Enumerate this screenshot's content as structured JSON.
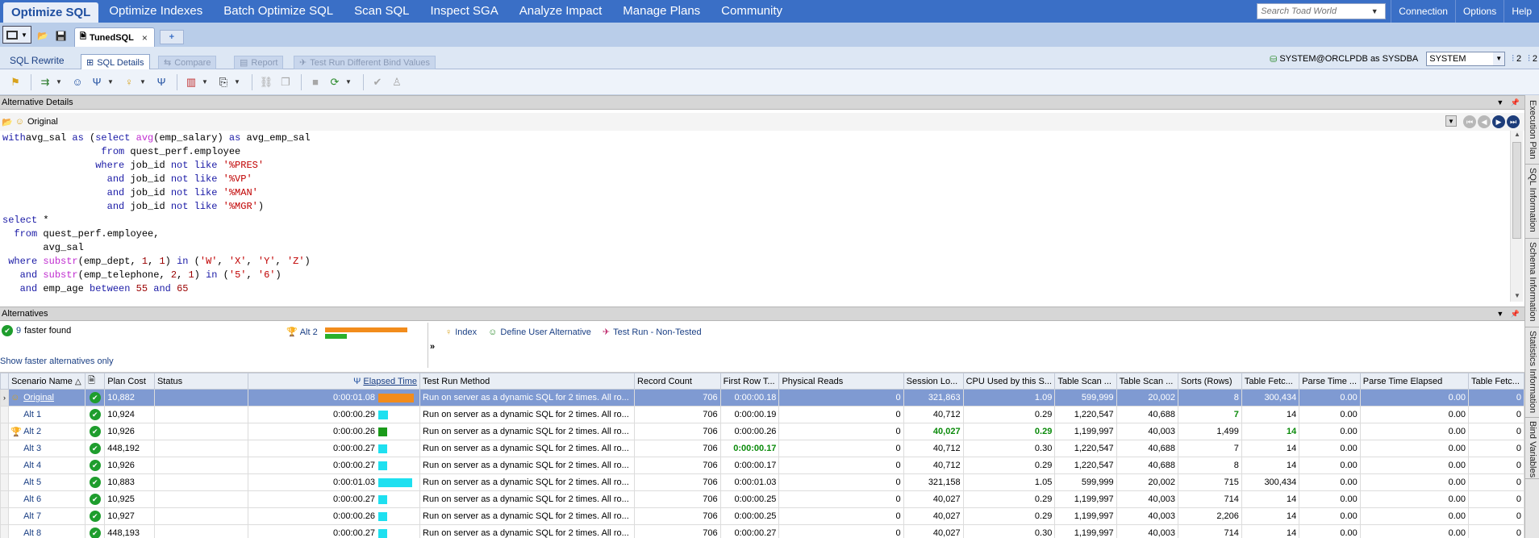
{
  "topnav": {
    "menu": [
      "Optimize SQL",
      "Optimize Indexes",
      "Batch Optimize SQL",
      "Scan SQL",
      "Inspect SGA",
      "Analyze Impact",
      "Manage Plans",
      "Community"
    ],
    "search_placeholder": "Search Toad World",
    "right_links": [
      "Connection",
      "Options",
      "Help"
    ]
  },
  "doc_tab": {
    "label": "TunedSQL",
    "close": "×",
    "add": "+"
  },
  "subtabs": {
    "sql_rewrite": "SQL Rewrite",
    "sql_details": "SQL Details",
    "compare": "Compare",
    "report": "Report",
    "test_run": "Test Run Different Bind Values"
  },
  "connection": {
    "label": "SYSTEM@ORCLPDB as SYSDBA",
    "schema": "SYSTEM",
    "count1": "2",
    "count2": "2"
  },
  "alt_details": {
    "title": "Alternative Details",
    "selected": "Original"
  },
  "sql_lines": [
    [
      [
        "kw",
        "with"
      ],
      [
        "",
        "avg_sal "
      ],
      [
        "kw",
        "as"
      ],
      [
        "",
        " ("
      ],
      [
        "kw",
        "select"
      ],
      [
        "",
        " "
      ],
      [
        "fn",
        "avg"
      ],
      [
        "",
        "(emp_salary) "
      ],
      [
        "kw",
        "as"
      ],
      [
        "",
        " avg_emp_sal"
      ]
    ],
    [
      [
        "",
        "                 "
      ],
      [
        "kw",
        "from"
      ],
      [
        "",
        " quest_perf.employee"
      ]
    ],
    [
      [
        "",
        "                "
      ],
      [
        "kw",
        "where"
      ],
      [
        "",
        " job_id "
      ],
      [
        "kw",
        "not like"
      ],
      [
        "",
        " "
      ],
      [
        "st",
        "'%PRES'"
      ]
    ],
    [
      [
        "",
        "                  "
      ],
      [
        "kw",
        "and"
      ],
      [
        "",
        " job_id "
      ],
      [
        "kw",
        "not like"
      ],
      [
        "",
        " "
      ],
      [
        "st",
        "'%VP'"
      ]
    ],
    [
      [
        "",
        "                  "
      ],
      [
        "kw",
        "and"
      ],
      [
        "",
        " job_id "
      ],
      [
        "kw",
        "not like"
      ],
      [
        "",
        " "
      ],
      [
        "st",
        "'%MAN'"
      ]
    ],
    [
      [
        "",
        "                  "
      ],
      [
        "kw",
        "and"
      ],
      [
        "",
        " job_id "
      ],
      [
        "kw",
        "not like"
      ],
      [
        "",
        " "
      ],
      [
        "st",
        "'%MGR'"
      ],
      [
        "",
        ")"
      ]
    ],
    [
      [
        "kw",
        "select"
      ],
      [
        "",
        " *"
      ]
    ],
    [
      [
        "",
        "  "
      ],
      [
        "kw",
        "from"
      ],
      [
        "",
        " quest_perf.employee,"
      ]
    ],
    [
      [
        "",
        "       avg_sal"
      ]
    ],
    [
      [
        "",
        ""
      ],
      [
        "kw",
        " where"
      ],
      [
        "",
        " "
      ],
      [
        "fn",
        "substr"
      ],
      [
        "",
        "(emp_dept, "
      ],
      [
        "nm",
        "1"
      ],
      [
        "",
        ", "
      ],
      [
        "nm",
        "1"
      ],
      [
        "",
        ") "
      ],
      [
        "kw",
        "in"
      ],
      [
        "",
        " ("
      ],
      [
        "st",
        "'W'"
      ],
      [
        "",
        ", "
      ],
      [
        "st",
        "'X'"
      ],
      [
        "",
        ", "
      ],
      [
        "st",
        "'Y'"
      ],
      [
        "",
        ", "
      ],
      [
        "st",
        "'Z'"
      ],
      [
        "",
        ")"
      ]
    ],
    [
      [
        "",
        "   "
      ],
      [
        "kw",
        "and"
      ],
      [
        "",
        " "
      ],
      [
        "fn",
        "substr"
      ],
      [
        "",
        "(emp_telephone, "
      ],
      [
        "nm",
        "2"
      ],
      [
        "",
        ", "
      ],
      [
        "nm",
        "1"
      ],
      [
        "",
        ") "
      ],
      [
        "kw",
        "in"
      ],
      [
        "",
        " ("
      ],
      [
        "st",
        "'5'"
      ],
      [
        "",
        ", "
      ],
      [
        "st",
        "'6'"
      ],
      [
        "",
        ")"
      ]
    ],
    [
      [
        "",
        "   "
      ],
      [
        "kw",
        "and"
      ],
      [
        "",
        " emp_age "
      ],
      [
        "kw",
        "between"
      ],
      [
        "",
        " "
      ],
      [
        "nm",
        "55"
      ],
      [
        "",
        " "
      ],
      [
        "kw",
        "and"
      ],
      [
        "",
        " "
      ],
      [
        "nm",
        "65"
      ]
    ]
  ],
  "side_tabs": [
    "Execution Plan",
    "SQL Information",
    "Schema Information",
    "Statistics Information",
    "Bind Variables"
  ],
  "alternatives": {
    "title": "Alternatives",
    "faster_count": "9",
    "faster_text": "faster found",
    "best_label": "Alt 2",
    "best_bar_fraction": 0.26,
    "actions": [
      "Index",
      "Define User Alternative",
      "Test Run - Non-Tested"
    ],
    "show_faster": "Show faster alternatives only",
    "more": "»"
  },
  "grid": {
    "columns": [
      "Scenario Name",
      "",
      "Plan Cost",
      "Status",
      "Elapsed Time",
      "Test Run Method",
      "Record Count",
      "First Row T...",
      "Physical Reads",
      "Session Lo...",
      "CPU Used by this S...",
      "Table Scan ...",
      "Table Scan ...",
      "Sorts (Rows)",
      "Table Fetc...",
      "Parse Time ...",
      "Parse Time Elapsed",
      "Table Fetc..."
    ],
    "rows": [
      {
        "name": "Original",
        "cost": "10,882",
        "status": "",
        "elapsed": "0:00:01.08",
        "bar": 1.0,
        "bar_color": "#f28c1c",
        "method": "Run on server as a dynamic SQL for 2 times. All ro...",
        "records": "706",
        "first": "0:00:00.18",
        "phys": "0",
        "session": "321,863",
        "cpu": "1.09",
        "ts1": "599,999",
        "ts2": "20,002",
        "sorts": "8",
        "tf1": "300,434",
        "pt": "0.00",
        "pte": "0.00",
        "tf2": "0"
      },
      {
        "name": "Alt 1",
        "cost": "10,924",
        "status": "",
        "elapsed": "0:00:00.29",
        "bar": 0.27,
        "bar_color": "#1ee0f0",
        "method": "Run on server as a dynamic SQL for 2 times. All ro...",
        "records": "706",
        "first": "0:00:00.19",
        "phys": "0",
        "session": "40,712",
        "cpu": "0.29",
        "ts1": "1,220,547",
        "ts2": "40,688",
        "sorts": "7",
        "tf1": "14",
        "pt": "0.00",
        "pte": "0.00",
        "tf2": "0",
        "green": [
          "sorts"
        ]
      },
      {
        "name": "Alt 2",
        "cost": "10,926",
        "status": "",
        "elapsed": "0:00:00.26",
        "bar": 0.24,
        "bar_color": "#1a9a1a",
        "method": "Run on server as a dynamic SQL for 2 times. All ro...",
        "records": "706",
        "first": "0:00:00.26",
        "phys": "0",
        "session": "40,027",
        "cpu": "0.29",
        "ts1": "1,199,997",
        "ts2": "40,003",
        "sorts": "1,499",
        "tf1": "14",
        "pt": "0.00",
        "pte": "0.00",
        "tf2": "0",
        "green": [
          "session",
          "cpu",
          "tf1"
        ],
        "trophy": true
      },
      {
        "name": "Alt 3",
        "cost": "448,192",
        "status": "",
        "elapsed": "0:00:00.27",
        "bar": 0.25,
        "bar_color": "#1ee0f0",
        "method": "Run on server as a dynamic SQL for 2 times. All ro...",
        "records": "706",
        "first": "0:00:00.17",
        "phys": "0",
        "session": "40,712",
        "cpu": "0.30",
        "ts1": "1,220,547",
        "ts2": "40,688",
        "sorts": "7",
        "tf1": "14",
        "pt": "0.00",
        "pte": "0.00",
        "tf2": "0",
        "green": [
          "first"
        ]
      },
      {
        "name": "Alt 4",
        "cost": "10,926",
        "status": "",
        "elapsed": "0:00:00.27",
        "bar": 0.25,
        "bar_color": "#1ee0f0",
        "method": "Run on server as a dynamic SQL for 2 times. All ro...",
        "records": "706",
        "first": "0:00:00.17",
        "phys": "0",
        "session": "40,712",
        "cpu": "0.29",
        "ts1": "1,220,547",
        "ts2": "40,688",
        "sorts": "8",
        "tf1": "14",
        "pt": "0.00",
        "pte": "0.00",
        "tf2": "0"
      },
      {
        "name": "Alt 5",
        "cost": "10,883",
        "status": "",
        "elapsed": "0:00:01.03",
        "bar": 0.95,
        "bar_color": "#1ee0f0",
        "method": "Run on server as a dynamic SQL for 2 times. All ro...",
        "records": "706",
        "first": "0:00:01.03",
        "phys": "0",
        "session": "321,158",
        "cpu": "1.05",
        "ts1": "599,999",
        "ts2": "20,002",
        "sorts": "715",
        "tf1": "300,434",
        "pt": "0.00",
        "pte": "0.00",
        "tf2": "0"
      },
      {
        "name": "Alt 6",
        "cost": "10,925",
        "status": "",
        "elapsed": "0:00:00.27",
        "bar": 0.25,
        "bar_color": "#1ee0f0",
        "method": "Run on server as a dynamic SQL for 2 times. All ro...",
        "records": "706",
        "first": "0:00:00.25",
        "phys": "0",
        "session": "40,027",
        "cpu": "0.29",
        "ts1": "1,199,997",
        "ts2": "40,003",
        "sorts": "714",
        "tf1": "14",
        "pt": "0.00",
        "pte": "0.00",
        "tf2": "0"
      },
      {
        "name": "Alt 7",
        "cost": "10,927",
        "status": "",
        "elapsed": "0:00:00.26",
        "bar": 0.24,
        "bar_color": "#1ee0f0",
        "method": "Run on server as a dynamic SQL for 2 times. All ro...",
        "records": "706",
        "first": "0:00:00.25",
        "phys": "0",
        "session": "40,027",
        "cpu": "0.29",
        "ts1": "1,199,997",
        "ts2": "40,003",
        "sorts": "2,206",
        "tf1": "14",
        "pt": "0.00",
        "pte": "0.00",
        "tf2": "0"
      },
      {
        "name": "Alt 8",
        "cost": "448,193",
        "status": "",
        "elapsed": "0:00:00.27",
        "bar": 0.25,
        "bar_color": "#1ee0f0",
        "method": "Run on server as a dynamic SQL for 2 times. All ro...",
        "records": "706",
        "first": "0:00:00.27",
        "phys": "0",
        "session": "40,027",
        "cpu": "0.30",
        "ts1": "1,199,997",
        "ts2": "40,003",
        "sorts": "714",
        "tf1": "14",
        "pt": "0.00",
        "pte": "0.00",
        "tf2": "0"
      }
    ]
  },
  "colors": {
    "nav_blue": "#3a6fc6",
    "selected_row": "#7f9ad2",
    "best_green": "#0a8a0a"
  }
}
